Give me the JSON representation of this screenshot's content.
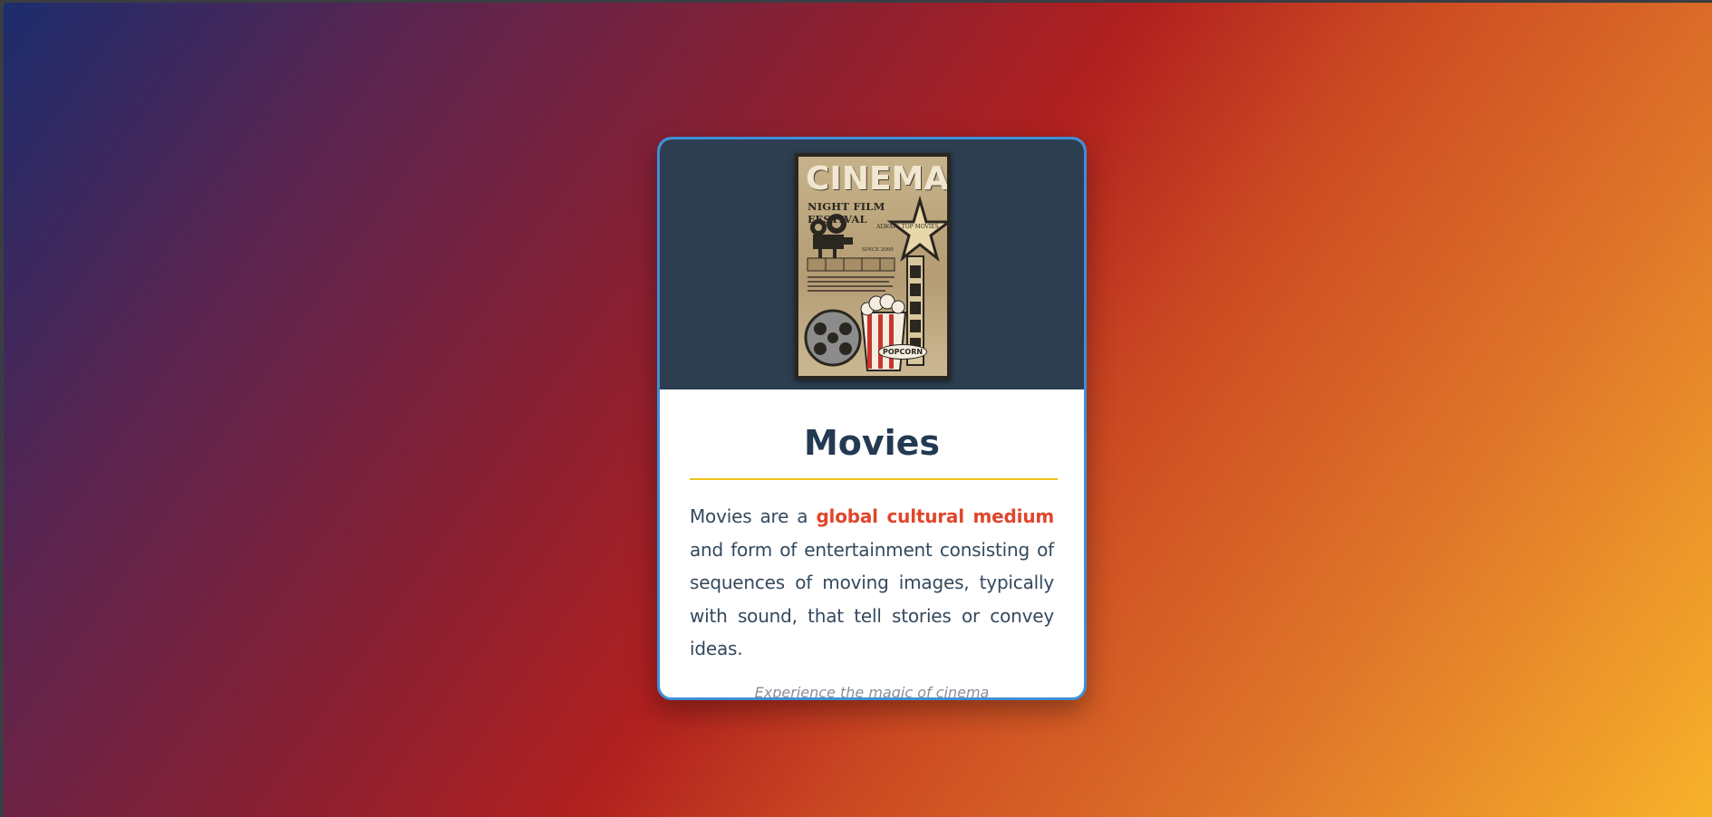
{
  "card": {
    "poster": {
      "title": "CINEMA",
      "subtitle": "NIGHT FILM FESTIVAL",
      "tag": "ALWAYS TOP MOVIES",
      "badge": "SINCE 2000",
      "popcorn": "POPCORN"
    },
    "title": "Movies",
    "description": {
      "before": "Movies are a ",
      "highlight": "global cultural medium",
      "after": " and form of entertainment consisting of sequences of moving images, typically with sound, that tell stories or convey ideas."
    },
    "tagline": "Experience the magic of cinema"
  },
  "colors": {
    "header_bg": "#2c3e50",
    "card_border": "#3f8fd8",
    "title": "#243a52",
    "divider": "#f0c419",
    "highlight": "#e0462b",
    "tagline": "#8a8f96"
  }
}
